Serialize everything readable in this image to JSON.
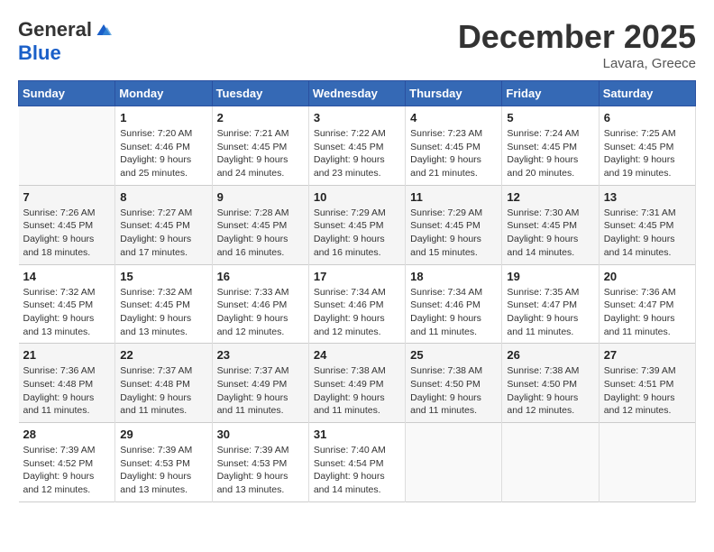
{
  "logo": {
    "general": "General",
    "blue": "Blue"
  },
  "header": {
    "month_year": "December 2025",
    "location": "Lavara, Greece"
  },
  "weekdays": [
    "Sunday",
    "Monday",
    "Tuesday",
    "Wednesday",
    "Thursday",
    "Friday",
    "Saturday"
  ],
  "weeks": [
    [
      {
        "day": "",
        "sunrise": "",
        "sunset": "",
        "daylight": ""
      },
      {
        "day": "1",
        "sunrise": "Sunrise: 7:20 AM",
        "sunset": "Sunset: 4:46 PM",
        "daylight": "Daylight: 9 hours and 25 minutes."
      },
      {
        "day": "2",
        "sunrise": "Sunrise: 7:21 AM",
        "sunset": "Sunset: 4:45 PM",
        "daylight": "Daylight: 9 hours and 24 minutes."
      },
      {
        "day": "3",
        "sunrise": "Sunrise: 7:22 AM",
        "sunset": "Sunset: 4:45 PM",
        "daylight": "Daylight: 9 hours and 23 minutes."
      },
      {
        "day": "4",
        "sunrise": "Sunrise: 7:23 AM",
        "sunset": "Sunset: 4:45 PM",
        "daylight": "Daylight: 9 hours and 21 minutes."
      },
      {
        "day": "5",
        "sunrise": "Sunrise: 7:24 AM",
        "sunset": "Sunset: 4:45 PM",
        "daylight": "Daylight: 9 hours and 20 minutes."
      },
      {
        "day": "6",
        "sunrise": "Sunrise: 7:25 AM",
        "sunset": "Sunset: 4:45 PM",
        "daylight": "Daylight: 9 hours and 19 minutes."
      }
    ],
    [
      {
        "day": "7",
        "sunrise": "Sunrise: 7:26 AM",
        "sunset": "Sunset: 4:45 PM",
        "daylight": "Daylight: 9 hours and 18 minutes."
      },
      {
        "day": "8",
        "sunrise": "Sunrise: 7:27 AM",
        "sunset": "Sunset: 4:45 PM",
        "daylight": "Daylight: 9 hours and 17 minutes."
      },
      {
        "day": "9",
        "sunrise": "Sunrise: 7:28 AM",
        "sunset": "Sunset: 4:45 PM",
        "daylight": "Daylight: 9 hours and 16 minutes."
      },
      {
        "day": "10",
        "sunrise": "Sunrise: 7:29 AM",
        "sunset": "Sunset: 4:45 PM",
        "daylight": "Daylight: 9 hours and 16 minutes."
      },
      {
        "day": "11",
        "sunrise": "Sunrise: 7:29 AM",
        "sunset": "Sunset: 4:45 PM",
        "daylight": "Daylight: 9 hours and 15 minutes."
      },
      {
        "day": "12",
        "sunrise": "Sunrise: 7:30 AM",
        "sunset": "Sunset: 4:45 PM",
        "daylight": "Daylight: 9 hours and 14 minutes."
      },
      {
        "day": "13",
        "sunrise": "Sunrise: 7:31 AM",
        "sunset": "Sunset: 4:45 PM",
        "daylight": "Daylight: 9 hours and 14 minutes."
      }
    ],
    [
      {
        "day": "14",
        "sunrise": "Sunrise: 7:32 AM",
        "sunset": "Sunset: 4:45 PM",
        "daylight": "Daylight: 9 hours and 13 minutes."
      },
      {
        "day": "15",
        "sunrise": "Sunrise: 7:32 AM",
        "sunset": "Sunset: 4:45 PM",
        "daylight": "Daylight: 9 hours and 13 minutes."
      },
      {
        "day": "16",
        "sunrise": "Sunrise: 7:33 AM",
        "sunset": "Sunset: 4:46 PM",
        "daylight": "Daylight: 9 hours and 12 minutes."
      },
      {
        "day": "17",
        "sunrise": "Sunrise: 7:34 AM",
        "sunset": "Sunset: 4:46 PM",
        "daylight": "Daylight: 9 hours and 12 minutes."
      },
      {
        "day": "18",
        "sunrise": "Sunrise: 7:34 AM",
        "sunset": "Sunset: 4:46 PM",
        "daylight": "Daylight: 9 hours and 11 minutes."
      },
      {
        "day": "19",
        "sunrise": "Sunrise: 7:35 AM",
        "sunset": "Sunset: 4:47 PM",
        "daylight": "Daylight: 9 hours and 11 minutes."
      },
      {
        "day": "20",
        "sunrise": "Sunrise: 7:36 AM",
        "sunset": "Sunset: 4:47 PM",
        "daylight": "Daylight: 9 hours and 11 minutes."
      }
    ],
    [
      {
        "day": "21",
        "sunrise": "Sunrise: 7:36 AM",
        "sunset": "Sunset: 4:48 PM",
        "daylight": "Daylight: 9 hours and 11 minutes."
      },
      {
        "day": "22",
        "sunrise": "Sunrise: 7:37 AM",
        "sunset": "Sunset: 4:48 PM",
        "daylight": "Daylight: 9 hours and 11 minutes."
      },
      {
        "day": "23",
        "sunrise": "Sunrise: 7:37 AM",
        "sunset": "Sunset: 4:49 PM",
        "daylight": "Daylight: 9 hours and 11 minutes."
      },
      {
        "day": "24",
        "sunrise": "Sunrise: 7:38 AM",
        "sunset": "Sunset: 4:49 PM",
        "daylight": "Daylight: 9 hours and 11 minutes."
      },
      {
        "day": "25",
        "sunrise": "Sunrise: 7:38 AM",
        "sunset": "Sunset: 4:50 PM",
        "daylight": "Daylight: 9 hours and 11 minutes."
      },
      {
        "day": "26",
        "sunrise": "Sunrise: 7:38 AM",
        "sunset": "Sunset: 4:50 PM",
        "daylight": "Daylight: 9 hours and 12 minutes."
      },
      {
        "day": "27",
        "sunrise": "Sunrise: 7:39 AM",
        "sunset": "Sunset: 4:51 PM",
        "daylight": "Daylight: 9 hours and 12 minutes."
      }
    ],
    [
      {
        "day": "28",
        "sunrise": "Sunrise: 7:39 AM",
        "sunset": "Sunset: 4:52 PM",
        "daylight": "Daylight: 9 hours and 12 minutes."
      },
      {
        "day": "29",
        "sunrise": "Sunrise: 7:39 AM",
        "sunset": "Sunset: 4:53 PM",
        "daylight": "Daylight: 9 hours and 13 minutes."
      },
      {
        "day": "30",
        "sunrise": "Sunrise: 7:39 AM",
        "sunset": "Sunset: 4:53 PM",
        "daylight": "Daylight: 9 hours and 13 minutes."
      },
      {
        "day": "31",
        "sunrise": "Sunrise: 7:40 AM",
        "sunset": "Sunset: 4:54 PM",
        "daylight": "Daylight: 9 hours and 14 minutes."
      },
      {
        "day": "",
        "sunrise": "",
        "sunset": "",
        "daylight": ""
      },
      {
        "day": "",
        "sunrise": "",
        "sunset": "",
        "daylight": ""
      },
      {
        "day": "",
        "sunrise": "",
        "sunset": "",
        "daylight": ""
      }
    ]
  ]
}
